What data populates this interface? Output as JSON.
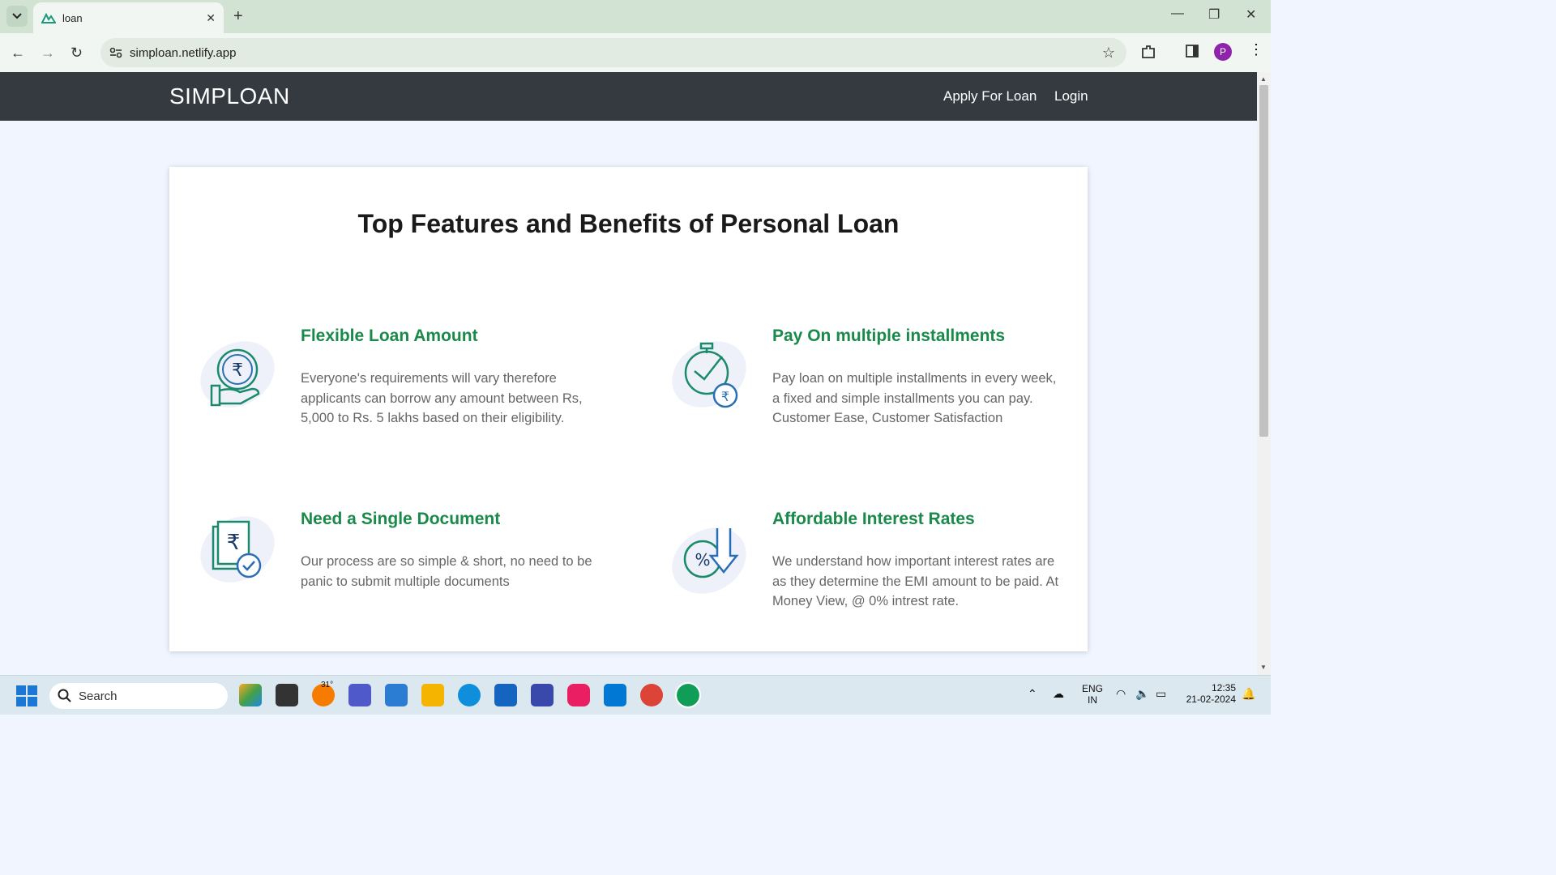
{
  "browser": {
    "tab_title": "loan",
    "url": "simploan.netlify.app",
    "profile_initial": "P"
  },
  "nav": {
    "brand": "SIMPLOAN",
    "links": [
      "Apply For Loan",
      "Login"
    ]
  },
  "section": {
    "title": "Top Features and Benefits of Personal Loan",
    "features": [
      {
        "title": "Flexible Loan Amount",
        "text": "Everyone's requirements will vary therefore applicants can borrow any amount between Rs, 5,000 to Rs. 5 lakhs based on their eligibility.",
        "icon": "rupee-hand-icon"
      },
      {
        "title": "Pay On multiple installments",
        "text": "Pay loan on multiple installments in every week, a fixed and simple installments you can pay. Customer Ease, Customer Satisfaction",
        "icon": "stopwatch-rupee-icon"
      },
      {
        "title": "Need a Single Document",
        "text": "Our process are so simple & short, no need to be panic to submit multiple documents",
        "icon": "document-check-icon"
      },
      {
        "title": "Affordable Interest Rates",
        "text": "We understand how important interest rates are as they determine the EMI amount to be paid. At Money View, @ 0% intrest rate.",
        "icon": "percent-down-icon"
      }
    ]
  },
  "taskbar": {
    "search_label": "Search",
    "weather_temp": "31°",
    "lang_line1": "ENG",
    "lang_line2": "IN",
    "time": "12:35",
    "date": "21-02-2024"
  },
  "colors": {
    "accent_green": "#1a8a4a",
    "navbar": "#343a40",
    "page_bg": "#f0f5ff"
  }
}
